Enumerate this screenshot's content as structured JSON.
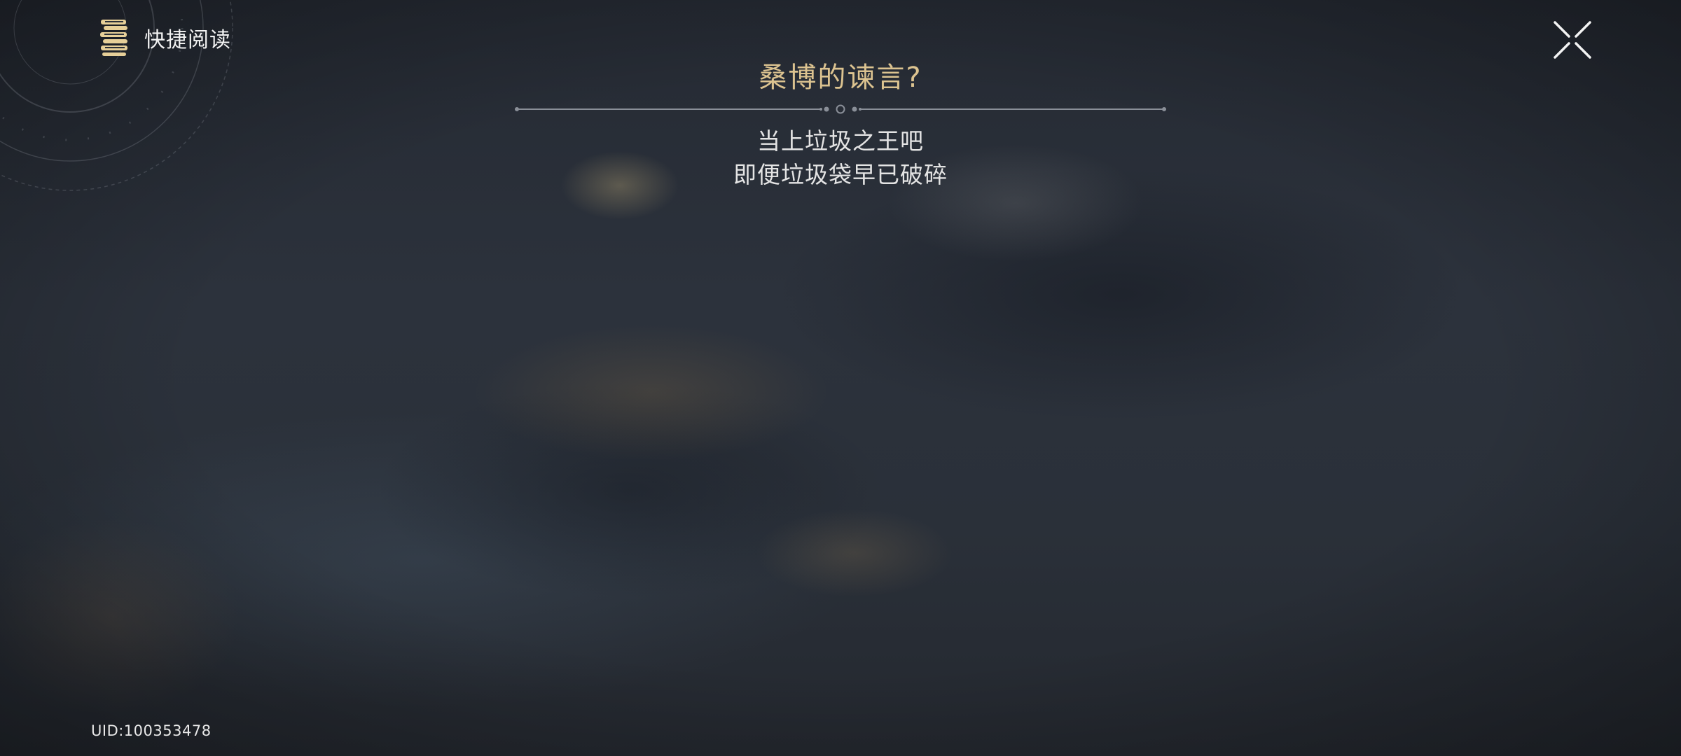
{
  "header": {
    "quick_read_label": "快捷阅读",
    "quick_read_icon": "book-stack-icon",
    "close_icon": "close-x-icon"
  },
  "reading": {
    "title": "桑博的谏言?",
    "lines": [
      "当上垃圾之王吧",
      "即便垃圾袋早已破碎"
    ]
  },
  "footer": {
    "uid": "UID:100353478"
  },
  "colors": {
    "title_gold": "#dcc390",
    "icon_gold": "#e6cf98",
    "text_light": "#e4e4e4",
    "divider_gray": "#8a8f98"
  }
}
